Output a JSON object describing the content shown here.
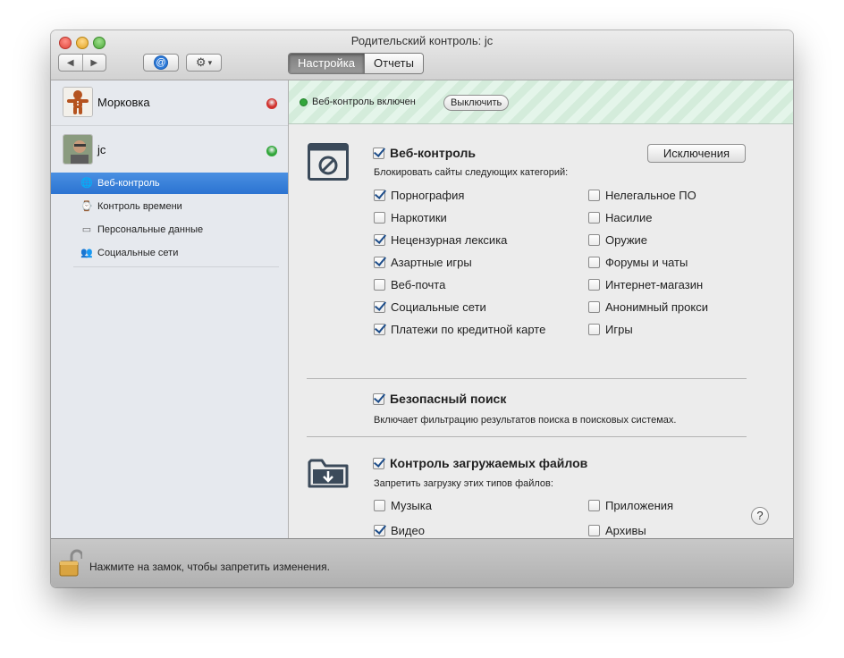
{
  "window": {
    "title": "Родительский контроль: jc"
  },
  "toolbar": {
    "back_icon": "◀",
    "forward_icon": "▶",
    "mail_icon": "@",
    "gear_icon": "⚙",
    "gear_caret": "▾",
    "tabs": [
      {
        "label": "Настройка",
        "active": true
      },
      {
        "label": "Отчеты",
        "active": false
      }
    ]
  },
  "sidebar": {
    "users": [
      {
        "name": "Морковка",
        "status": "red",
        "status_color": "#d0312d"
      },
      {
        "name": "jc",
        "status": "green",
        "status_color": "#31a63a"
      }
    ],
    "items": [
      {
        "label": "Веб-контроль",
        "icon": "globe-icon",
        "selected": true
      },
      {
        "label": "Контроль времени",
        "icon": "watch-icon",
        "selected": false
      },
      {
        "label": "Персональные данные",
        "icon": "id-card-icon",
        "selected": false
      },
      {
        "label": "Социальные сети",
        "icon": "people-icon",
        "selected": false
      }
    ]
  },
  "banner": {
    "text": "Веб-контроль включен",
    "button": "Выключить"
  },
  "web_control": {
    "title": "Веб-контроль",
    "checked": true,
    "subtitle": "Блокировать сайты следующих категорий:",
    "exceptions_button": "Исключения",
    "left": [
      {
        "label": "Порнография",
        "checked": true
      },
      {
        "label": "Наркотики",
        "checked": false
      },
      {
        "label": "Нецензурная лексика",
        "checked": true
      },
      {
        "label": "Азартные игры",
        "checked": true
      },
      {
        "label": "Веб-почта",
        "checked": false
      },
      {
        "label": "Социальные сети",
        "checked": true
      },
      {
        "label": "Платежи по кредитной карте",
        "checked": true
      }
    ],
    "right": [
      {
        "label": "Нелегальное ПО",
        "checked": false
      },
      {
        "label": "Насилие",
        "checked": false
      },
      {
        "label": "Оружие",
        "checked": false
      },
      {
        "label": "Форумы и чаты",
        "checked": false
      },
      {
        "label": "Интернет-магазин",
        "checked": false
      },
      {
        "label": "Анонимный прокси",
        "checked": false
      },
      {
        "label": "Игры",
        "checked": false
      }
    ]
  },
  "safe_search": {
    "title": "Безопасный поиск",
    "checked": true,
    "description": "Включает фильтрацию результатов поиска в поисковых системах."
  },
  "downloads": {
    "title": "Контроль загружаемых файлов",
    "checked": true,
    "subtitle": "Запретить загрузку этих типов файлов:",
    "left": [
      {
        "label": "Музыка",
        "checked": false
      },
      {
        "label": "Видео",
        "checked": true
      }
    ],
    "right": [
      {
        "label": "Приложения",
        "checked": false
      },
      {
        "label": "Архивы",
        "checked": false
      }
    ]
  },
  "help": "?",
  "footer": {
    "lock_text": "Нажмите на замок, чтобы запретить изменения."
  }
}
